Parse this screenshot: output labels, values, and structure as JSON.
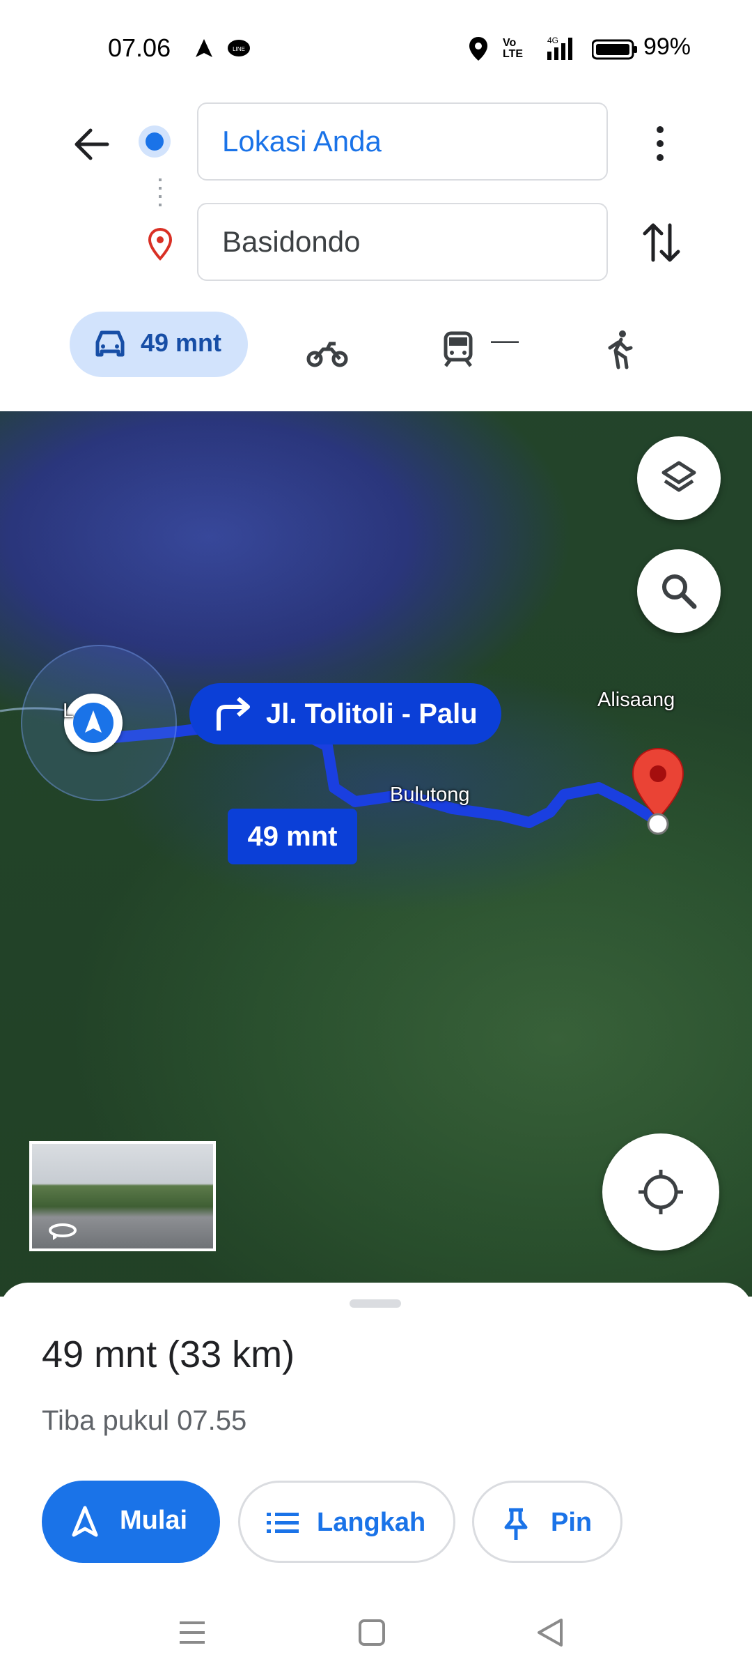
{
  "status_bar": {
    "time": "07.06",
    "network": "Vo LTE 4G",
    "battery": "99%"
  },
  "directions": {
    "origin_value": "Lokasi Anda",
    "destination_value": "Basidondo"
  },
  "modes": {
    "car_time": "49 mnt",
    "transit_time": "—"
  },
  "map": {
    "turn_instruction": "Jl. Tolitoli - Palu",
    "route_time": "49 mnt",
    "labels": {
      "origin_partial": "L",
      "bulutong": "Bulutong",
      "alisaang": "Alisaang"
    },
    "colors": {
      "route": "#1a3fe0",
      "callout": "#0b3fd7",
      "destination_pin": "#d93025"
    }
  },
  "summary": {
    "duration_distance": "49 mnt (33 km)",
    "arrival": "Tiba pukul 07.55"
  },
  "actions": {
    "start_label": "Mulai",
    "steps_label": "Langkah",
    "pin_label": "Pin"
  },
  "icons": [
    "back-arrow-icon",
    "more-vert-icon",
    "swap-icon",
    "car-icon",
    "motorcycle-icon",
    "train-icon",
    "walk-icon",
    "layers-icon",
    "search-icon",
    "my-location-icon",
    "navigation-icon",
    "list-icon",
    "pin-icon",
    "menu-icon",
    "home-square-icon",
    "back-triangle-icon"
  ]
}
